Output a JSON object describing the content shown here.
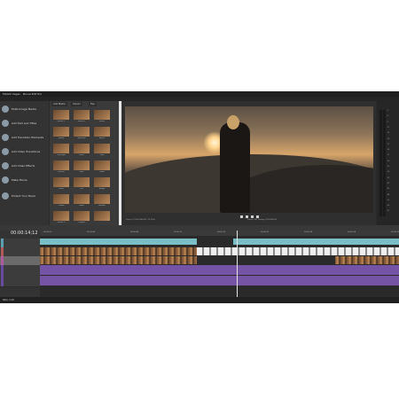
{
  "window": {
    "title_left": "MAGIX Vegas",
    "title_right": "Movie Edit Pro"
  },
  "left_panel": {
    "items": [
      {
        "label": "Multi-Image Media",
        "icon": "film-icon"
      },
      {
        "label": "Add Text and Titles",
        "icon": "text-icon"
      },
      {
        "label": "Add Transition Elements",
        "icon": "transition-icon"
      },
      {
        "label": "Add Video Transitions",
        "icon": "video-transition-icon"
      },
      {
        "label": "Add Video Effects",
        "icon": "effects-icon"
      },
      {
        "label": "Make Movie",
        "icon": "movie-icon"
      },
      {
        "label": "Protect Your Music",
        "icon": "music-icon"
      }
    ]
  },
  "media_pool": {
    "tabs": [
      "Add Media",
      "Import",
      "Exp"
    ],
    "thumbnails": [
      {
        "label": "Desert 1"
      },
      {
        "label": "Desert 2"
      },
      {
        "label": "Forest"
      },
      {
        "label": "Sunset"
      },
      {
        "label": "Mountain"
      },
      {
        "label": "Beach"
      },
      {
        "label": "City Night"
      },
      {
        "label": "River"
      },
      {
        "label": "Lake"
      },
      {
        "label": "Portrait"
      },
      {
        "label": "Field"
      },
      {
        "label": "Dawn"
      },
      {
        "label": "Snow"
      },
      {
        "label": "Cliff"
      },
      {
        "label": "Bridge"
      },
      {
        "label": "Clouds"
      },
      {
        "label": "Road"
      },
      {
        "label": "Horizon"
      },
      {
        "label": "Desert 3"
      },
      {
        "label": "Canyon"
      },
      {
        "label": ""
      }
    ]
  },
  "preview": {
    "info_left": "Project: 1920x1080x32, 29.970p",
    "info_right": "Frame: 441  Display: 470x264x32"
  },
  "meters": {
    "scale": [
      "-3",
      "-6",
      "-9",
      "-12",
      "-15",
      "-18",
      "-21",
      "-24",
      "-27",
      "-30",
      "-33",
      "-36",
      "-39",
      "-42",
      "-45",
      "-48",
      "-51",
      "-54",
      "-57"
    ]
  },
  "timeline": {
    "timecode": "00:00:14;12",
    "ruler": [
      "00:00:00",
      "00:00:04",
      "00:00:08",
      "00:00:12",
      "00:00:16",
      "00:00:20",
      "00:00:24",
      "00:00:28",
      "00:00:32"
    ],
    "status": "Rate: 0.00"
  },
  "colors": {
    "accent": "#7bbfc6",
    "audio": "#6a4aa0"
  }
}
